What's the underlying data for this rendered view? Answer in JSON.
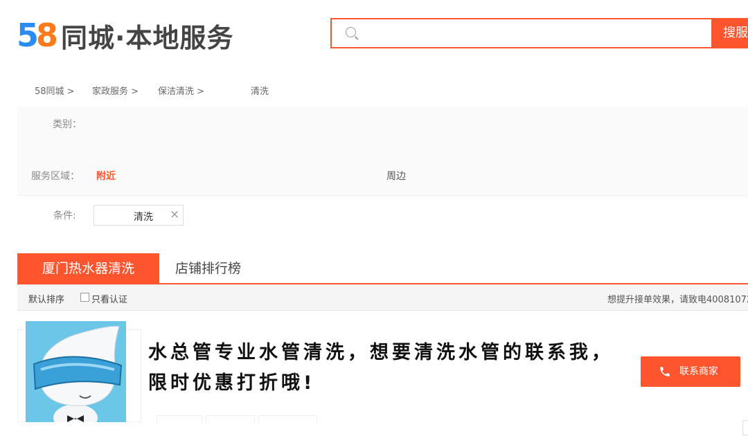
{
  "header": {
    "logo_digit_5": "5",
    "logo_digit_8": "8",
    "logo_text": "同城·本地服务",
    "search_placeholder": "",
    "search_button": "搜服"
  },
  "breadcrumb": [
    "58同城 >",
    "家政服务 >",
    "保洁清洗 >",
    "清洗"
  ],
  "filters": {
    "category_label": "类别：",
    "area_label": "服务区域：",
    "area_active": "附近",
    "area_other": "周边",
    "condition_label": "条件:",
    "condition_chip": "清洗",
    "chip_close": "×"
  },
  "tabs": [
    {
      "label": "厦门热水器清洗",
      "active": true
    },
    {
      "label": "店铺排行榜",
      "active": false
    }
  ],
  "sortbar": {
    "default_sort": "默认排序",
    "verified_only": "只看认证",
    "promo_text": "想提升接单效果，请致电40081072"
  },
  "listing": {
    "title": "水总管专业水管清洗，想要清洗水管的联系我，限时优惠打折哦!",
    "contact_button": "联系商家"
  },
  "colors": {
    "accent": "#ff552e",
    "logo_blue": "#2a8cf0",
    "logo_orange": "#ff7a1a",
    "thumb_bg": "#6cc6e8"
  },
  "icons": [
    "search-icon",
    "close-icon",
    "checkbox-icon",
    "phone-icon",
    "mascot-avatar"
  ]
}
